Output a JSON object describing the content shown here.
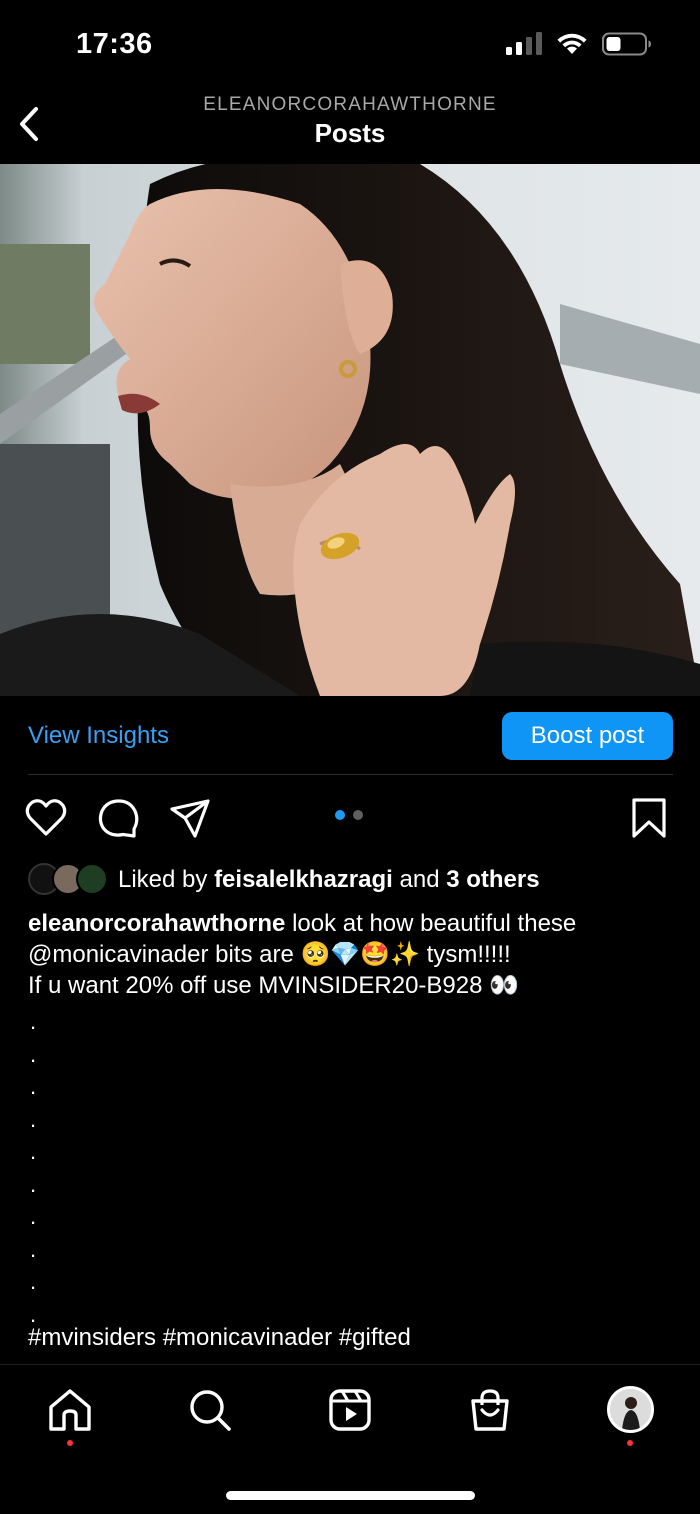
{
  "status_bar": {
    "time": "17:36",
    "icons": [
      "cellular-signal-icon",
      "wifi-icon",
      "battery-icon"
    ]
  },
  "header": {
    "username": "ELEANORCORAHAWTHORNE",
    "title": "Posts",
    "back_icon": "chevron-left-icon"
  },
  "post": {
    "image": "portrait photo",
    "insights_label": "View Insights",
    "boost_label": "Boost post",
    "carousel": {
      "count": 2,
      "active": 1
    },
    "actions": [
      "heart-icon",
      "comment-icon",
      "share-icon",
      "bookmark-icon"
    ],
    "likes": {
      "prefix": "Liked by",
      "user": "feisalelkhazragi",
      "middle": "and",
      "others": "3 others"
    },
    "caption": {
      "username": "eleanorcorahawthorne",
      "line1": "look at how beautiful these",
      "line2": "@monicavinader bits are 🥺💎🤩✨ tysm!!!!!",
      "line3": "If u want 20% off use MVINSIDER20-B928 👀",
      "dots": [
        ".",
        ".",
        ".",
        ".",
        ".",
        ".",
        ".",
        ".",
        ".",
        "."
      ],
      "hashtags": "#mvinsiders #monicavinader #gifted"
    }
  },
  "bottom_nav": {
    "items": [
      "home-icon",
      "search-icon",
      "reels-icon",
      "shop-icon",
      "profile-avatar"
    ],
    "notification_color": "#ff3040"
  },
  "colors": {
    "accent": "#0e95f6",
    "link": "#3aa0f2",
    "background": "#000000"
  }
}
